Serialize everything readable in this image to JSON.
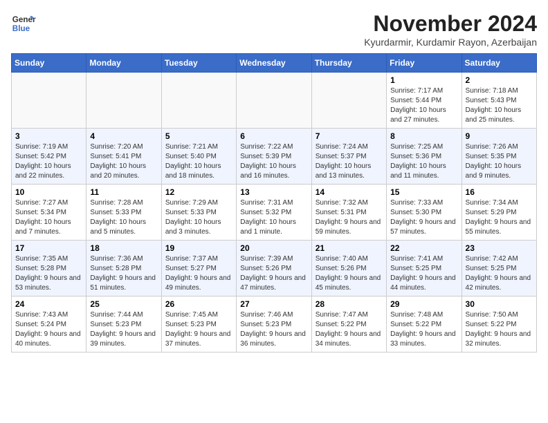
{
  "logo": {
    "line1": "General",
    "line2": "Blue"
  },
  "title": "November 2024",
  "location": "Kyurdarmir, Kurdamir Rayon, Azerbaijan",
  "weekdays": [
    "Sunday",
    "Monday",
    "Tuesday",
    "Wednesday",
    "Thursday",
    "Friday",
    "Saturday"
  ],
  "weeks": [
    [
      {
        "day": "",
        "info": ""
      },
      {
        "day": "",
        "info": ""
      },
      {
        "day": "",
        "info": ""
      },
      {
        "day": "",
        "info": ""
      },
      {
        "day": "",
        "info": ""
      },
      {
        "day": "1",
        "info": "Sunrise: 7:17 AM\nSunset: 5:44 PM\nDaylight: 10 hours and 27 minutes."
      },
      {
        "day": "2",
        "info": "Sunrise: 7:18 AM\nSunset: 5:43 PM\nDaylight: 10 hours and 25 minutes."
      }
    ],
    [
      {
        "day": "3",
        "info": "Sunrise: 7:19 AM\nSunset: 5:42 PM\nDaylight: 10 hours and 22 minutes."
      },
      {
        "day": "4",
        "info": "Sunrise: 7:20 AM\nSunset: 5:41 PM\nDaylight: 10 hours and 20 minutes."
      },
      {
        "day": "5",
        "info": "Sunrise: 7:21 AM\nSunset: 5:40 PM\nDaylight: 10 hours and 18 minutes."
      },
      {
        "day": "6",
        "info": "Sunrise: 7:22 AM\nSunset: 5:39 PM\nDaylight: 10 hours and 16 minutes."
      },
      {
        "day": "7",
        "info": "Sunrise: 7:24 AM\nSunset: 5:37 PM\nDaylight: 10 hours and 13 minutes."
      },
      {
        "day": "8",
        "info": "Sunrise: 7:25 AM\nSunset: 5:36 PM\nDaylight: 10 hours and 11 minutes."
      },
      {
        "day": "9",
        "info": "Sunrise: 7:26 AM\nSunset: 5:35 PM\nDaylight: 10 hours and 9 minutes."
      }
    ],
    [
      {
        "day": "10",
        "info": "Sunrise: 7:27 AM\nSunset: 5:34 PM\nDaylight: 10 hours and 7 minutes."
      },
      {
        "day": "11",
        "info": "Sunrise: 7:28 AM\nSunset: 5:33 PM\nDaylight: 10 hours and 5 minutes."
      },
      {
        "day": "12",
        "info": "Sunrise: 7:29 AM\nSunset: 5:33 PM\nDaylight: 10 hours and 3 minutes."
      },
      {
        "day": "13",
        "info": "Sunrise: 7:31 AM\nSunset: 5:32 PM\nDaylight: 10 hours and 1 minute."
      },
      {
        "day": "14",
        "info": "Sunrise: 7:32 AM\nSunset: 5:31 PM\nDaylight: 9 hours and 59 minutes."
      },
      {
        "day": "15",
        "info": "Sunrise: 7:33 AM\nSunset: 5:30 PM\nDaylight: 9 hours and 57 minutes."
      },
      {
        "day": "16",
        "info": "Sunrise: 7:34 AM\nSunset: 5:29 PM\nDaylight: 9 hours and 55 minutes."
      }
    ],
    [
      {
        "day": "17",
        "info": "Sunrise: 7:35 AM\nSunset: 5:28 PM\nDaylight: 9 hours and 53 minutes."
      },
      {
        "day": "18",
        "info": "Sunrise: 7:36 AM\nSunset: 5:28 PM\nDaylight: 9 hours and 51 minutes."
      },
      {
        "day": "19",
        "info": "Sunrise: 7:37 AM\nSunset: 5:27 PM\nDaylight: 9 hours and 49 minutes."
      },
      {
        "day": "20",
        "info": "Sunrise: 7:39 AM\nSunset: 5:26 PM\nDaylight: 9 hours and 47 minutes."
      },
      {
        "day": "21",
        "info": "Sunrise: 7:40 AM\nSunset: 5:26 PM\nDaylight: 9 hours and 45 minutes."
      },
      {
        "day": "22",
        "info": "Sunrise: 7:41 AM\nSunset: 5:25 PM\nDaylight: 9 hours and 44 minutes."
      },
      {
        "day": "23",
        "info": "Sunrise: 7:42 AM\nSunset: 5:25 PM\nDaylight: 9 hours and 42 minutes."
      }
    ],
    [
      {
        "day": "24",
        "info": "Sunrise: 7:43 AM\nSunset: 5:24 PM\nDaylight: 9 hours and 40 minutes."
      },
      {
        "day": "25",
        "info": "Sunrise: 7:44 AM\nSunset: 5:23 PM\nDaylight: 9 hours and 39 minutes."
      },
      {
        "day": "26",
        "info": "Sunrise: 7:45 AM\nSunset: 5:23 PM\nDaylight: 9 hours and 37 minutes."
      },
      {
        "day": "27",
        "info": "Sunrise: 7:46 AM\nSunset: 5:23 PM\nDaylight: 9 hours and 36 minutes."
      },
      {
        "day": "28",
        "info": "Sunrise: 7:47 AM\nSunset: 5:22 PM\nDaylight: 9 hours and 34 minutes."
      },
      {
        "day": "29",
        "info": "Sunrise: 7:48 AM\nSunset: 5:22 PM\nDaylight: 9 hours and 33 minutes."
      },
      {
        "day": "30",
        "info": "Sunrise: 7:50 AM\nSunset: 5:22 PM\nDaylight: 9 hours and 32 minutes."
      }
    ]
  ]
}
